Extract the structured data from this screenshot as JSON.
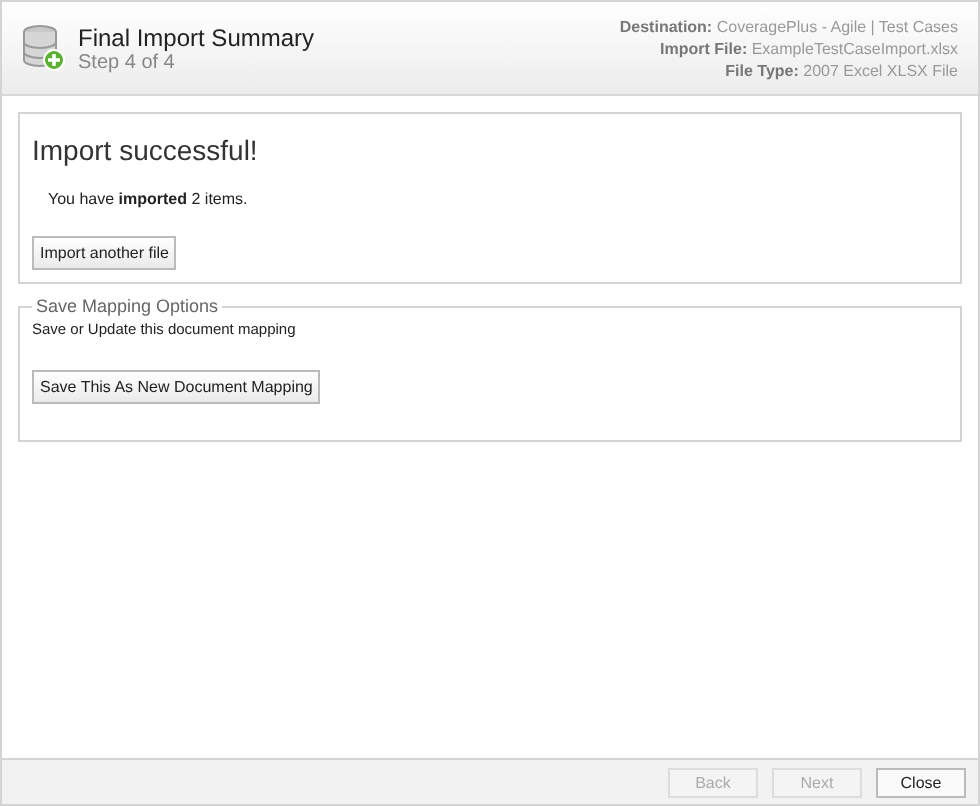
{
  "header": {
    "title": "Final Import Summary",
    "step": "Step 4 of 4",
    "details": [
      {
        "label": "Destination:",
        "value": "CoveragePlus - Agile | Test Cases"
      },
      {
        "label": "Import File:",
        "value": "ExampleTestCaseImport.xlsx"
      },
      {
        "label": "File Type:",
        "value": "2007 Excel XLSX File"
      }
    ]
  },
  "result": {
    "heading": "Import successful!",
    "message": "You have **imported** 2 items.",
    "button": "Import another file"
  },
  "mapping": {
    "legend": "Save Mapping Options",
    "text": "Save or Update this document mapping",
    "button": "Save This As New Document Mapping"
  },
  "footer_buttons": [
    {
      "label": "Back",
      "disabled": true
    },
    {
      "label": "Next",
      "disabled": true
    },
    {
      "label": "Close",
      "disabled": false
    }
  ]
}
